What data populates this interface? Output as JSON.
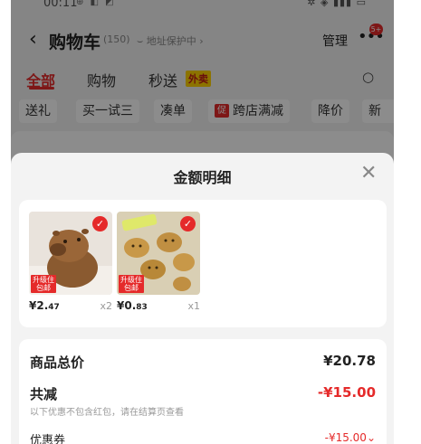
{
  "status_bar": {
    "time": "00:11",
    "app_icons": "⊕ ◧ ◩"
  },
  "header": {
    "title": "购物车",
    "count": "(150)",
    "address": "地址保护中",
    "manage": "管理",
    "more_badge": "5+"
  },
  "tabs": {
    "all": "全部",
    "shopping": "购物",
    "flash": "秒送",
    "takeout": "外卖"
  },
  "chips": {
    "gift": "送礼",
    "buy_try": "买一试三",
    "make_order": "凑单",
    "cross_store_icon": "促",
    "cross_store": "跨店满减",
    "price_drop": "降价",
    "more": "新"
  },
  "sheet": {
    "title": "金额明细",
    "products": [
      {
        "price_main": "¥2.",
        "price_decimal": "47",
        "qty": "x2",
        "badge_line1": "升级住",
        "badge_line2": "包邮"
      },
      {
        "price_main": "¥0.",
        "price_decimal": "83",
        "qty": "x1",
        "badge_line1": "升级住",
        "badge_line2": "包邮"
      }
    ],
    "summary": {
      "total_label": "商品总价",
      "total_value": "¥20.78",
      "discount_label": "共减",
      "discount_value": "-¥15.00",
      "discount_note": "以下优惠不包含红包，请在结算页查看",
      "coupon_label": "优惠券",
      "coupon_value": "-¥15.00"
    }
  },
  "colors": {
    "accent": "#e52a2a",
    "takeout_badge": "#ffd200"
  }
}
